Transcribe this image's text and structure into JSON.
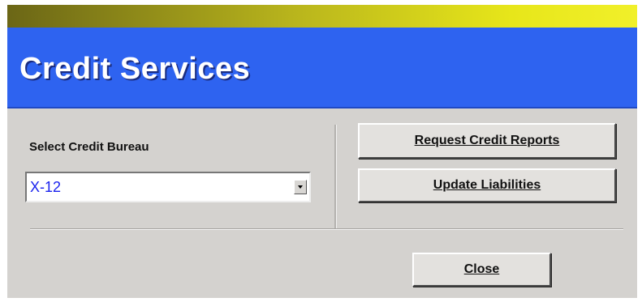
{
  "header": {
    "title": "Credit Services"
  },
  "bureau": {
    "label": "Select Credit Bureau",
    "selected": "X-12"
  },
  "buttons": {
    "request_reports": "Request Credit Reports",
    "update_liabilities": "Update Liabilities",
    "close": "Close"
  },
  "colors": {
    "header_blue": "#2e63f0",
    "title_gradient_start": "#6b6616",
    "title_gradient_end": "#f1f02a",
    "dialog_gray": "#d4d2cf",
    "selected_text": "#1a22ee"
  },
  "icons": {
    "dropdown": "chevron-down-icon"
  }
}
